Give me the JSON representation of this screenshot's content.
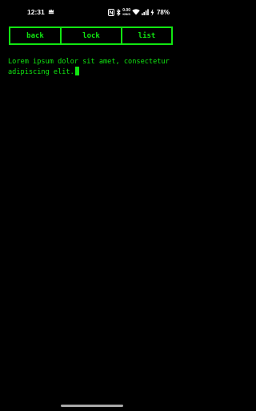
{
  "status_bar": {
    "time": "12:31",
    "data_speed_value": "0.00",
    "data_speed_unit": "KB/S",
    "battery": "78%",
    "icons": [
      "crown-icon",
      "nfc-icon",
      "bluetooth-icon",
      "wifi-icon",
      "signal-icon",
      "battery-charging-icon"
    ]
  },
  "toolbar": {
    "back_label": "back",
    "lock_label": "lock",
    "list_label": "list"
  },
  "editor": {
    "text": "Lorem ipsum dolor sit amet, consectetur adipiscing elit."
  },
  "colors": {
    "background": "#000000",
    "accent": "#11e611",
    "status_text": "#ffffff"
  }
}
